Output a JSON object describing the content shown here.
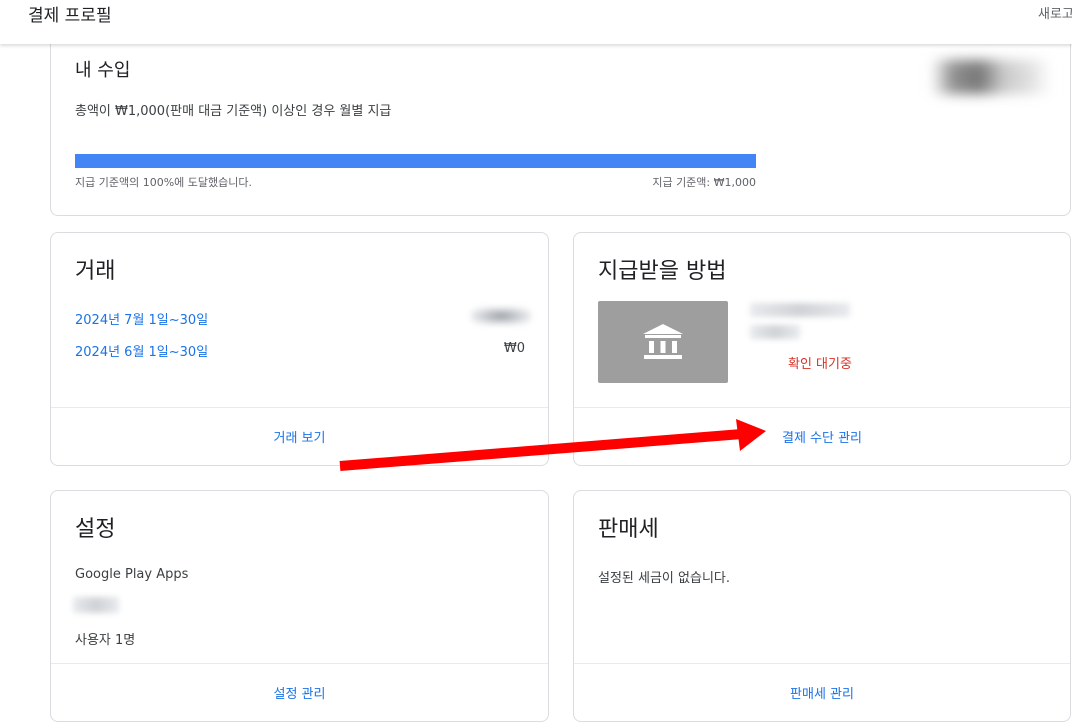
{
  "header": {
    "title": "결제 프로필",
    "right_text": "새로고"
  },
  "earnings": {
    "title": "내 수입",
    "description": "총액이 ₩1,000(판매 대금 기준액) 이상인 경우 월별 지급",
    "progress_fraction": 1.0,
    "progress_color": "#4285f4",
    "progress_left_label": "지급 기준액의 100%에 도달했습니다.",
    "progress_right_label": "지급 기준액: ₩1,000"
  },
  "transactions": {
    "title": "거래",
    "rows": [
      {
        "period": "2024년 7월 1일~30일",
        "amount": ""
      },
      {
        "period": "2024년 6월 1일~30일",
        "amount": "₩0"
      }
    ],
    "footer_link": "거래 보기"
  },
  "payout": {
    "title": "지급받을 방법",
    "bank_icon": "bank-icon",
    "status": "확인 대기중",
    "status_color": "#d93025",
    "footer_link": "결제 수단 관리"
  },
  "settings": {
    "title": "설정",
    "product": "Google Play Apps",
    "users_link": "사용자 1명",
    "footer_link": "설정 관리"
  },
  "sales_tax": {
    "title": "판매세",
    "message": "설정된 세금이 없습니다.",
    "footer_link": "판매세 관리"
  },
  "annotation": {
    "arrow_color": "#ff0000"
  }
}
